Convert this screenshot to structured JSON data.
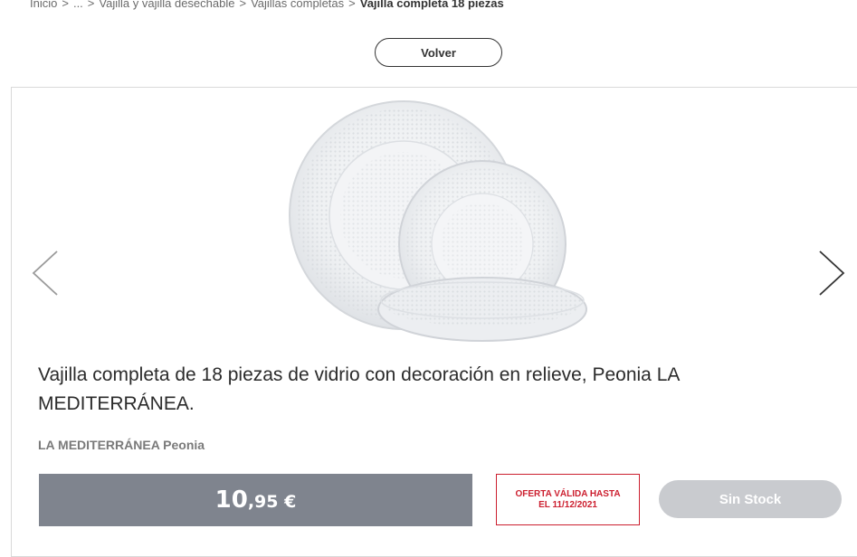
{
  "breadcrumb": {
    "items": [
      "Inicio",
      "...",
      "Vajilla y vajilla desechable",
      "Vajillas completas"
    ],
    "current": "Vajilla completa 18 piezas",
    "separator": ">"
  },
  "back_button": {
    "label": "Volver"
  },
  "product": {
    "title": "Vajilla completa de 18 piezas de vidrio con decoración en relieve, Peonia LA MEDITERRÁNEA.",
    "brand": "LA MEDITERRÁNEA Peonia",
    "image_icon": "glass-tableware-image",
    "price": {
      "integer": "10",
      "decimal": ",95",
      "currency": " €"
    },
    "offer": {
      "line1": "OFERTA VÁLIDA HASTA",
      "line2": "EL 11/12/2021"
    },
    "stock_label": "Sin Stock"
  },
  "carousel": {
    "prev_icon": "chevron-left-icon",
    "next_icon": "chevron-right-icon"
  },
  "colors": {
    "price_bg": "#7f848e",
    "offer_red": "#cc1f2f",
    "disabled_button": "#c9cbcf"
  }
}
